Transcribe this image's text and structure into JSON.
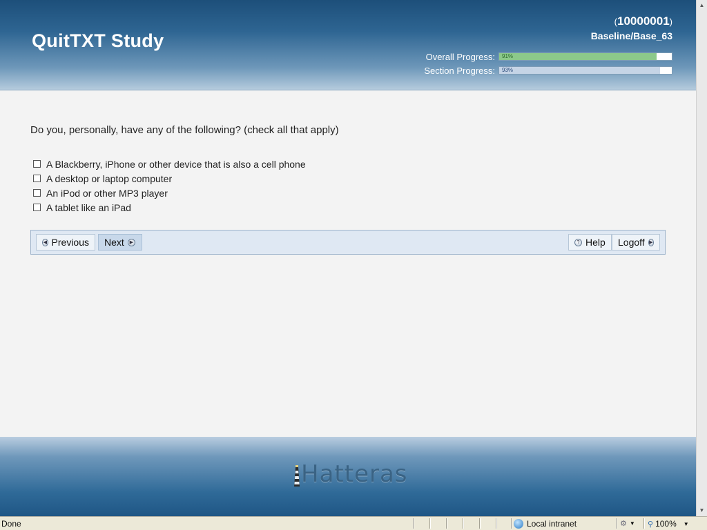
{
  "header": {
    "title": "QuitTXT Study",
    "user_id": "10000001",
    "location": "Baseline/Base_63",
    "overall_progress": {
      "label": "Overall Progress:",
      "percent_text": "91%",
      "value": 0.91,
      "color": "#8cc98a"
    },
    "section_progress": {
      "label": "Section Progress:",
      "percent_text": "93%",
      "value": 0.93,
      "color": "#c5d4e6"
    }
  },
  "question": {
    "text": "Do you, personally, have any of the following? (check all that apply)",
    "options": [
      "A Blackberry, iPhone or other device that is also a cell phone",
      "A desktop or laptop computer",
      "An iPod or other MP3 player",
      "A tablet like an iPad"
    ]
  },
  "nav": {
    "previous": "Previous",
    "next": "Next",
    "help": "Help",
    "logoff": "Logoff"
  },
  "footer": {
    "logo_text": "Hatteras"
  },
  "statusbar": {
    "status": "Done",
    "zone": "Local intranet",
    "zoom": "100%"
  }
}
